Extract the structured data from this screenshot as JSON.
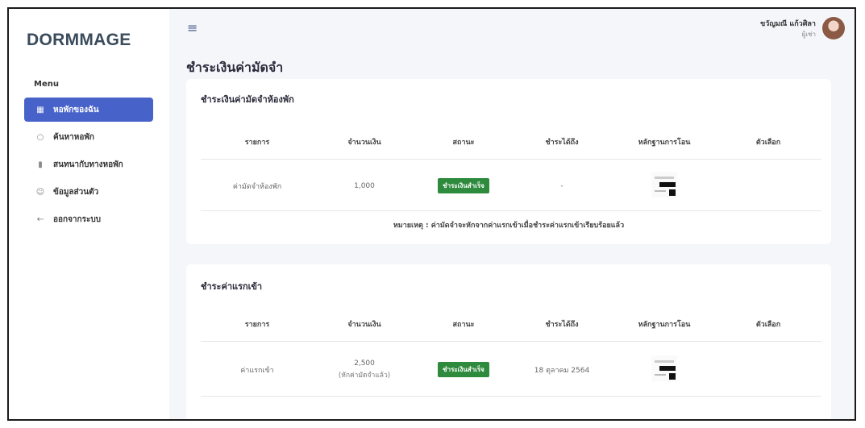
{
  "brand": "DORMMAGE",
  "menu_title": "Menu",
  "nav": [
    {
      "label": "หอพักของฉัน",
      "icon": "grid-icon"
    },
    {
      "label": "ค้นหาหอพัก",
      "icon": "search-icon"
    },
    {
      "label": "สนทนากับทางหอพัก",
      "icon": "bookmark-icon"
    },
    {
      "label": "ข้อมูลส่วนตัว",
      "icon": "user-icon"
    },
    {
      "label": "ออกจากระบบ",
      "icon": "logout-icon"
    }
  ],
  "user": {
    "name": "ขวัญมณี แก้วศิลา",
    "role": "ผู้เช่า"
  },
  "page_title": "ชำระเงินค่ามัดจำ",
  "deposit": {
    "title": "ชำระเงินค่ามัดจำห้องพัก",
    "columns": [
      "รายการ",
      "จำนวนเงิน",
      "สถานะ",
      "ชำระได้ถึง",
      "หลักฐานการโอน",
      "ตัวเลือก"
    ],
    "row": {
      "item": "ค่ามัดจำห้องพัก",
      "amount": "1,000",
      "status": "ชำระเงินสำเร็จ",
      "due": "-"
    },
    "note": "หมายเหตุ : ค่ามัดจำจะหักจากค่าแรกเข้าเมื่อชำระค่าแรกเข้าเรียบร้อยแล้ว"
  },
  "entry": {
    "title": "ชำระค่าแรกเข้า",
    "columns": [
      "รายการ",
      "จำนวนเงิน",
      "สถานะ",
      "ชำระได้ถึง",
      "หลักฐานการโอน",
      "ตัวเลือก"
    ],
    "row": {
      "item": "ค่าแรกเข้า",
      "amount": "2,500",
      "amount_note": "(หักค่ามัดจำแล้ว)",
      "status": "ชำระเงินสำเร็จ",
      "due": "18 ตุลาคม 2564"
    }
  },
  "colors": {
    "accent": "#4763c9",
    "success": "#2e8b3e"
  }
}
